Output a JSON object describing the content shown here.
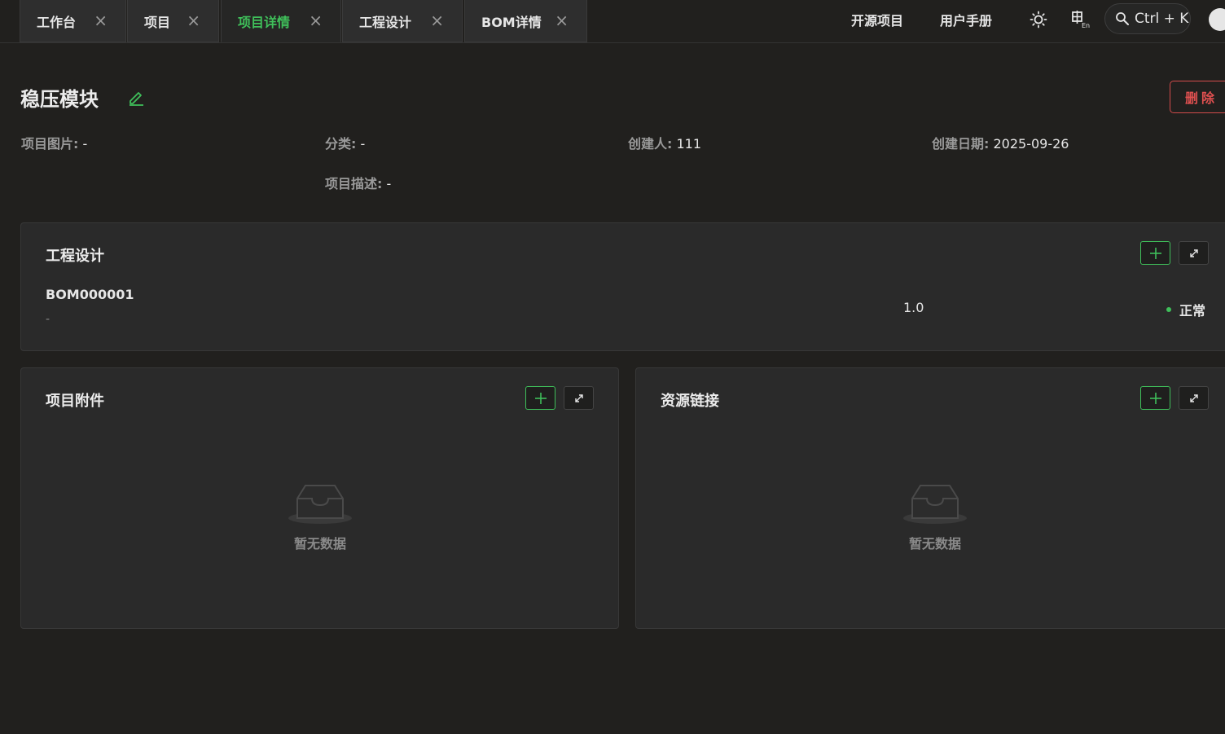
{
  "tabs": [
    {
      "label": "工作台",
      "active": false
    },
    {
      "label": "项目",
      "active": false
    },
    {
      "label": "项目详情",
      "active": true
    },
    {
      "label": "工程设计",
      "active": false
    },
    {
      "label": "BOM详情",
      "active": false
    }
  ],
  "nav": {
    "open_source": "开源项目",
    "user_manual": "用户手册",
    "search_shortcut": "Ctrl + K",
    "icons": [
      "sun-icon",
      "language-icon",
      "search-icon",
      "avatar-icon"
    ]
  },
  "project": {
    "title": "稳压模块",
    "delete_label": "删除",
    "fields": {
      "image_label": "项目图片:",
      "image_value": "-",
      "category_label": "分类:",
      "category_value": "-",
      "creator_label": "创建人:",
      "creator_value": "111",
      "created_label": "创建日期:",
      "created_value": "2025-09-26",
      "desc_label": "项目描述:",
      "desc_value": "-"
    }
  },
  "engineering": {
    "title": "工程设计",
    "items": [
      {
        "code": "BOM000001",
        "sub": "-",
        "version": "1.0",
        "status": "正常"
      }
    ]
  },
  "attachments": {
    "title": "项目附件",
    "empty_text": "暂无数据"
  },
  "resources": {
    "title": "资源链接",
    "empty_text": "暂无数据"
  },
  "colors": {
    "accent": "#3fbf5a",
    "danger": "#e05050",
    "background": "#21201e",
    "card": "#2a2a2a"
  }
}
